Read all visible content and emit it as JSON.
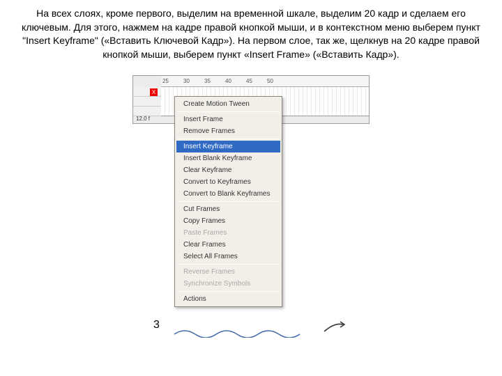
{
  "instruction_text": "На всех слоях, кроме первого, выделим на временной шкале, выделим 20 кадр и сделаем его ключевым. Для этого, нажмем на кадре правой кнопкой мыши, и в контекстном меню выберем пункт \"Insert Keyframe\" («Вставить Ключевой Кадр»). На первом слое, так же, щелкнув на 20 кадре правой кнопкой мыши, выберем пункт «Insert Frame» («Вставить Кадр»).",
  "ruler": [
    "25",
    "30",
    "35",
    "40",
    "45",
    "50"
  ],
  "fps": "12.0 f",
  "layer_x": "X",
  "bottom_num": "3",
  "menu": {
    "create_motion_tween": "Create Motion Tween",
    "insert_frame": "Insert Frame",
    "remove_frames": "Remove Frames",
    "insert_keyframe": "Insert Keyframe",
    "insert_blank_keyframe": "Insert Blank Keyframe",
    "clear_keyframe": "Clear Keyframe",
    "convert_to_keyframes": "Convert to Keyframes",
    "convert_to_blank_keyframes": "Convert to Blank Keyframes",
    "cut_frames": "Cut Frames",
    "copy_frames": "Copy Frames",
    "paste_frames": "Paste Frames",
    "clear_frames": "Clear Frames",
    "select_all_frames": "Select All Frames",
    "reverse_frames": "Reverse Frames",
    "synchronize_symbols": "Synchronize Symbols",
    "actions": "Actions"
  }
}
